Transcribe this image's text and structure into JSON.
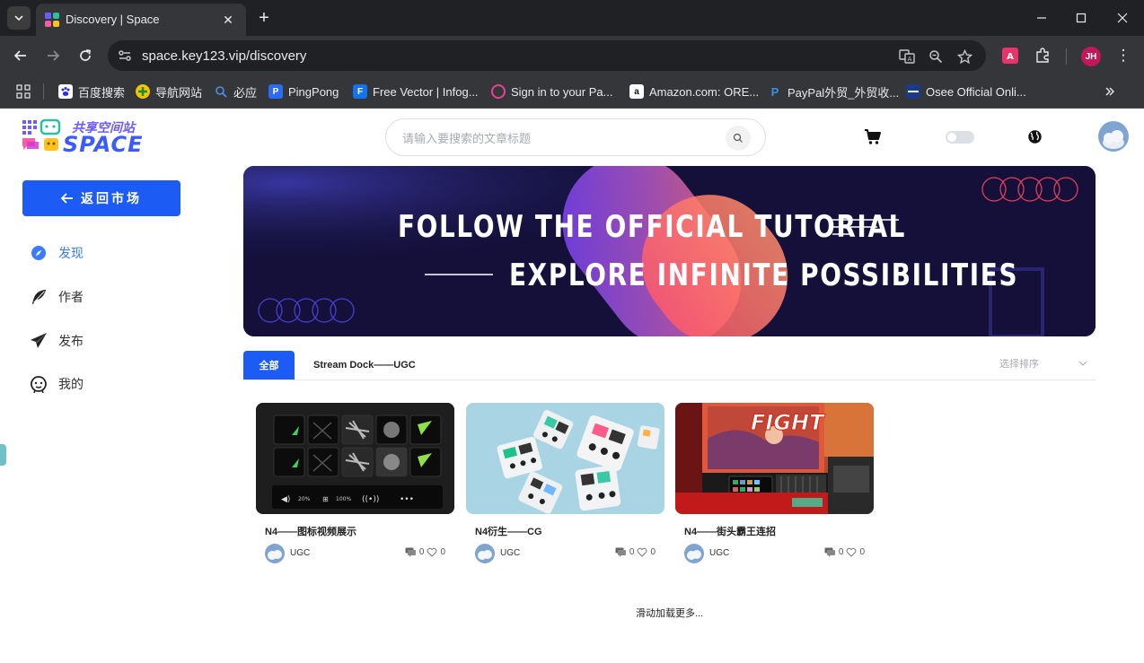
{
  "browser": {
    "tab_title": "Discovery | Space",
    "url": "space.key123.vip/discovery",
    "profile_initials": "JH",
    "bookmarks": [
      {
        "label": "百度搜索",
        "icon": "baidu-icon"
      },
      {
        "label": "导航网站",
        "icon": "nav-site-icon"
      },
      {
        "label": "必应",
        "icon": "bing-icon"
      },
      {
        "label": "PingPong",
        "icon": "pingpong-icon"
      },
      {
        "label": "Free Vector | Infog...",
        "icon": "freepik-icon"
      },
      {
        "label": "Sign in to your Pa...",
        "icon": "picsart-icon"
      },
      {
        "label": "Amazon.com: ORE...",
        "icon": "amazon-icon"
      },
      {
        "label": "PayPal外贸_外贸收...",
        "icon": "paypal-icon"
      },
      {
        "label": "Osee Official Onli...",
        "icon": "osee-icon"
      }
    ]
  },
  "header": {
    "logo_top": "共享空间站",
    "logo_bottom": "SPACE",
    "search_placeholder": "请输入要搜索的文章标题"
  },
  "sidebar": {
    "back_label": "返回市场",
    "items": [
      {
        "label": "发现",
        "icon": "compass-icon",
        "active": true
      },
      {
        "label": "作者",
        "icon": "feather-icon",
        "active": false
      },
      {
        "label": "发布",
        "icon": "paper-plane-icon",
        "active": false
      },
      {
        "label": "我的",
        "icon": "face-icon",
        "active": false
      }
    ]
  },
  "banner": {
    "line1": "FOLLOW THE OFFICIAL TUTORIAL",
    "line2": "EXPLORE INFINITE POSSIBILITIES"
  },
  "categories": {
    "tabs": [
      "全部",
      "Stream Dock——UGC"
    ],
    "sort_placeholder": "选择排序"
  },
  "cards": [
    {
      "title": "N4——图标视频展示",
      "author": "UGC",
      "comments": "0",
      "likes": "0"
    },
    {
      "title": "N4衍生——CG",
      "author": "UGC",
      "comments": "0",
      "likes": "0"
    },
    {
      "title": "N4——街头霸王连招",
      "author": "UGC",
      "comments": "0",
      "likes": "0"
    }
  ],
  "card1_overlay": {
    "fight": "FIGHT",
    "pct_a": "20%",
    "pct_b": "100%",
    "dots": "•••"
  },
  "load_more": "滑动加载更多...",
  "colors": {
    "accent": "#1c5cf5",
    "active_link": "#3a7bff",
    "banner_bg": "#14103a"
  }
}
